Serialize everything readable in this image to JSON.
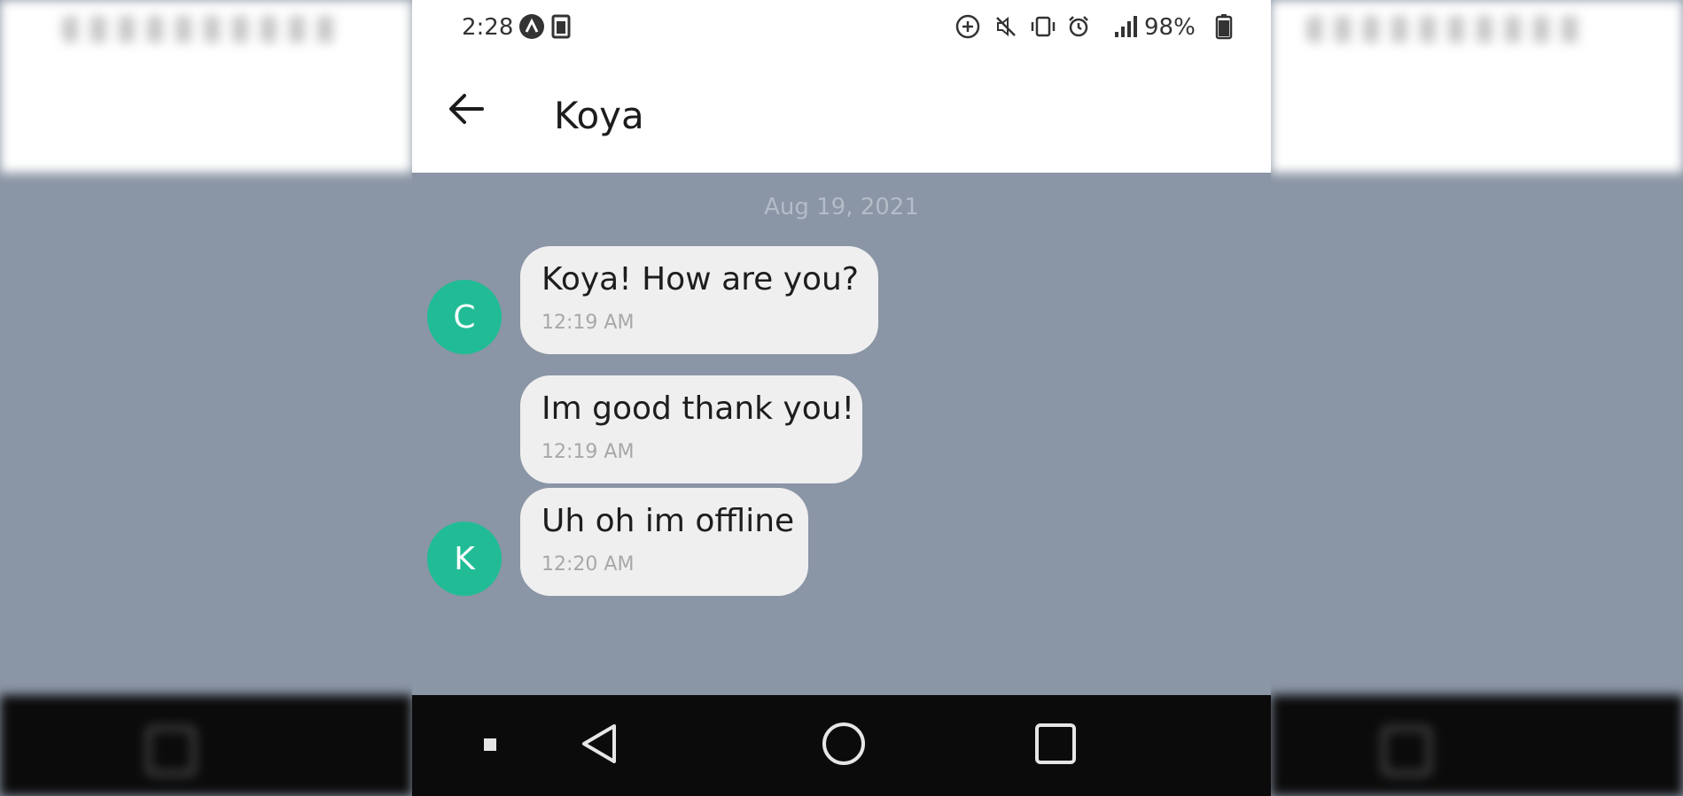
{
  "status_bar": {
    "time": "2:28",
    "battery": "98%",
    "icons": [
      "assistant-a-icon",
      "sim-card-icon",
      "add-circle-icon",
      "mute-icon",
      "vibrate-icon",
      "alarm-icon",
      "signal-icon",
      "battery-icon"
    ]
  },
  "header": {
    "back_icon": "arrow-back-icon",
    "title": "Koya"
  },
  "chat": {
    "date": "Aug 19, 2021",
    "messages": [
      {
        "avatar": "C",
        "text": "Koya! How are you?",
        "time": "12:19 AM"
      },
      {
        "avatar": "",
        "text": "Im good thank you!",
        "time": "12:19 AM"
      },
      {
        "avatar": "K",
        "text": "Uh oh im offline",
        "time": "12:20 AM"
      }
    ]
  },
  "navigation": {
    "buttons": [
      "small-square-icon",
      "back-triangle-icon",
      "home-circle-icon",
      "recents-square-icon"
    ]
  },
  "colors": {
    "chat_background": "#8a95a5",
    "avatar": "#21bc96",
    "bubble": "#efefef",
    "nav_bar": "#0b0b0b"
  }
}
